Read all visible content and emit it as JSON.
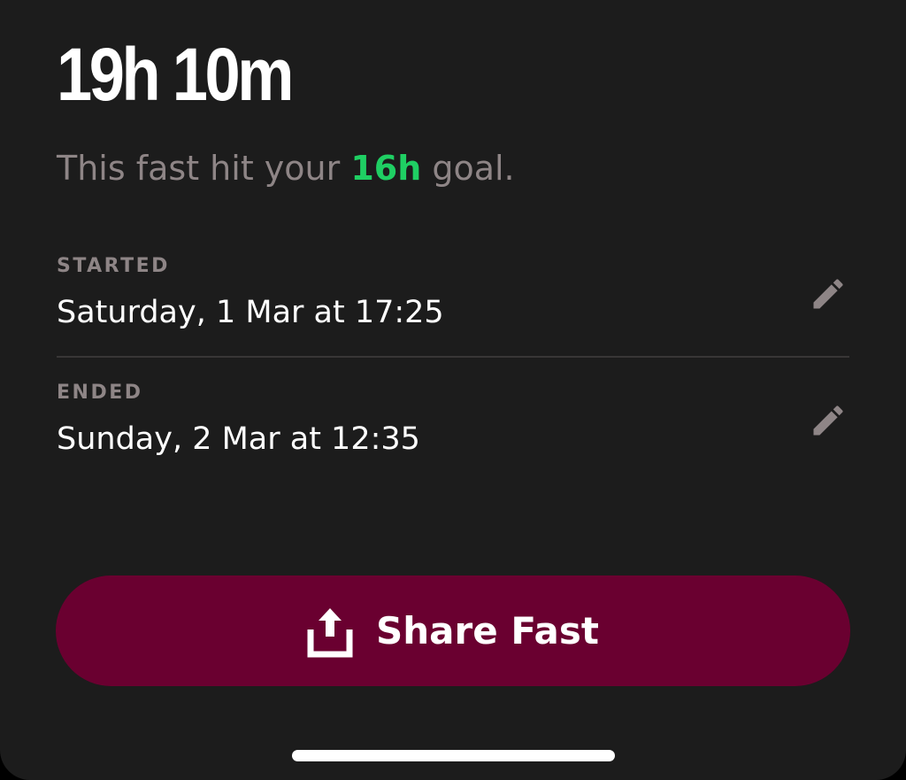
{
  "summary": {
    "duration": "19h 10m",
    "subtitle_before": "This fast hit your ",
    "goal_value": "16h",
    "subtitle_after": " goal."
  },
  "started": {
    "label": "STARTED",
    "value": "Saturday, 1 Mar at 17:25",
    "edit_icon": "pencil-icon"
  },
  "ended": {
    "label": "ENDED",
    "value": "Sunday, 2 Mar at 12:35",
    "edit_icon": "pencil-icon"
  },
  "share": {
    "label": "Share Fast",
    "icon": "share-upload-icon"
  },
  "colors": {
    "background": "#1c1c1c",
    "muted_text": "#8e8586",
    "goal_accent": "#1fcf63",
    "share_button": "#6a0030",
    "divider": "#383636"
  }
}
